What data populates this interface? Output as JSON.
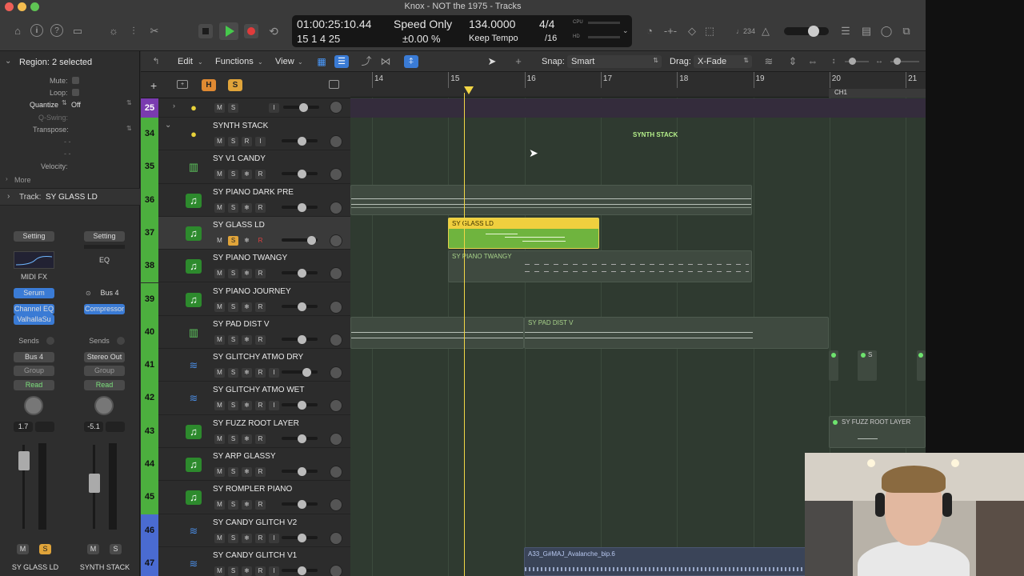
{
  "window": {
    "title": "Knox - NOT the 1975 - Tracks"
  },
  "lcd": {
    "time": "01:00:25:10.44",
    "bars": "15  1  4    25",
    "mode_top": "Speed Only",
    "mode_bottom": "±0.00 %",
    "tempo": "134.0000",
    "tempo_mode": "Keep Tempo",
    "sig_top": "4/4",
    "sig_bottom": "/16",
    "cpu_label": "CPU",
    "hd_label": "HD"
  },
  "toolbar": {
    "count_in": "♩234"
  },
  "inspector": {
    "region_header": "Region: 2 selected",
    "mute_label": "Mute:",
    "loop_label": "Loop:",
    "quantize_label": "Quantize",
    "quantize_value": "Off",
    "qswing_label": "Q-Swing:",
    "transpose_label": "Transpose:",
    "dash1": "-  -",
    "dash2": "-  -",
    "velocity_label": "Velocity:",
    "more_label": "More",
    "track_header_prefix": "Track:",
    "track_header_name": "SY GLASS LD",
    "left_strip": {
      "setting": "Setting",
      "midi_fx": "MIDI FX",
      "plugin1": "Serum",
      "plugin2": "Channel EQ",
      "plugin3": "ValhallaSu",
      "sends": "Sends",
      "output": "Bus 4",
      "group": "Group",
      "automation": "Read",
      "volume": "1.7",
      "m": "M",
      "s": "S",
      "name": "SY GLASS LD"
    },
    "right_strip": {
      "setting": "Setting",
      "eq": "EQ",
      "input": "Bus 4",
      "plugin1": "Compressor",
      "sends": "Sends",
      "output": "Stereo Out",
      "group": "Group",
      "automation": "Read",
      "volume": "-5.1",
      "m": "M",
      "s": "S",
      "name": "SYNTH STACK"
    }
  },
  "edit_toolbar": {
    "edit": "Edit",
    "functions": "Functions",
    "view": "View",
    "snap_label": "Snap:",
    "snap_value": "Smart",
    "drag_label": "Drag:",
    "drag_value": "X-Fade"
  },
  "track_header_top": {
    "h": "H",
    "s": "S"
  },
  "tracks": [
    {
      "num": "25",
      "name": "",
      "type": "folder",
      "color": "#7a3bb0"
    },
    {
      "num": "34",
      "name": "SYNTH STACK",
      "type": "stack",
      "color": "#4caf3e"
    },
    {
      "num": "35",
      "name": "SY V1 CANDY",
      "type": "synth",
      "color": "#4caf3e"
    },
    {
      "num": "36",
      "name": "SY PIANO DARK PRE",
      "type": "midi",
      "color": "#4caf3e"
    },
    {
      "num": "37",
      "name": "SY GLASS LD",
      "type": "midi",
      "color": "#4caf3e"
    },
    {
      "num": "38",
      "name": "SY PIANO TWANGY",
      "type": "midi",
      "color": "#4caf3e"
    },
    {
      "num": "39",
      "name": "SY PIANO JOURNEY",
      "type": "midi",
      "color": "#4caf3e"
    },
    {
      "num": "40",
      "name": "SY PAD DIST V",
      "type": "synth",
      "color": "#4caf3e"
    },
    {
      "num": "41",
      "name": "SY GLITCHY ATMO DRY",
      "type": "audio",
      "color": "#4caf3e"
    },
    {
      "num": "42",
      "name": "SY GLITCHY ATMO WET",
      "type": "audio",
      "color": "#4caf3e"
    },
    {
      "num": "43",
      "name": "SY FUZZ ROOT LAYER",
      "type": "midi",
      "color": "#4caf3e"
    },
    {
      "num": "44",
      "name": "SY ARP GLASSY",
      "type": "midi",
      "color": "#4caf3e"
    },
    {
      "num": "45",
      "name": "SY ROMPLER PIANO",
      "type": "midi",
      "color": "#4caf3e"
    },
    {
      "num": "46",
      "name": "SY CANDY GLITCH V2",
      "type": "audio",
      "color": "#4a6bd1"
    },
    {
      "num": "47",
      "name": "SY CANDY GLITCH V1",
      "type": "audio",
      "color": "#4a6bd1"
    }
  ],
  "buttons": {
    "m": "M",
    "s": "S",
    "r": "R",
    "i": "I",
    "frz": "❄"
  },
  "ruler": {
    "bars": [
      "14",
      "15",
      "16",
      "17",
      "18",
      "19",
      "20",
      "21"
    ],
    "marker": "CH1"
  },
  "regions": {
    "synth_stack": "SYNTH STACK",
    "glass_ld": "SY GLASS LD",
    "piano_twangy": "SY PIANO TWANGY",
    "pad_dist": "SY PAD DIST V",
    "fuzz_root": "SY FUZZ ROOT LAYER",
    "glitch_s": "S",
    "avalanche": "A33_G#MAJ_Avalanche_bip.6"
  },
  "colors": {
    "accent_blue": "#3a7bd5",
    "track_green": "#4caf3e",
    "region_selected": "#7bc142",
    "playhead": "#f2d646"
  }
}
